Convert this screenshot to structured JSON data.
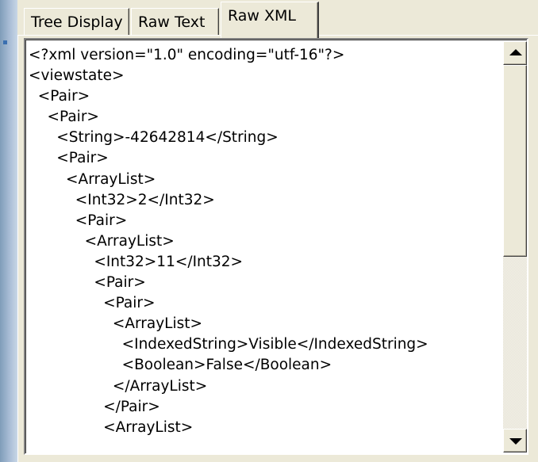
{
  "tabs": [
    {
      "label": "Tree Display",
      "selected": false
    },
    {
      "label": "Raw Text",
      "selected": false
    },
    {
      "label": "Raw XML",
      "selected": true
    }
  ],
  "xml_lines": [
    "<?xml version=\"1.0\" encoding=\"utf-16\"?>",
    "<viewstate>",
    "  <Pair>",
    "    <Pair>",
    "      <String>-42642814</String>",
    "      <Pair>",
    "        <ArrayList>",
    "          <Int32>2</Int32>",
    "          <Pair>",
    "            <ArrayList>",
    "              <Int32>11</Int32>",
    "              <Pair>",
    "                <Pair>",
    "                  <ArrayList>",
    "                    <IndexedString>Visible</IndexedString>",
    "                    <Boolean>False</Boolean>",
    "                  </ArrayList>",
    "                </Pair>",
    "                <ArrayList>"
  ],
  "scrollbar": {
    "up_icon": "arrow-up-icon",
    "down_icon": "arrow-down-icon",
    "thumb_position_fraction": 0.0
  },
  "colors": {
    "window_face": "#ece9d8",
    "text_background": "#ffffff",
    "side_strip": "#a9bdd6"
  }
}
